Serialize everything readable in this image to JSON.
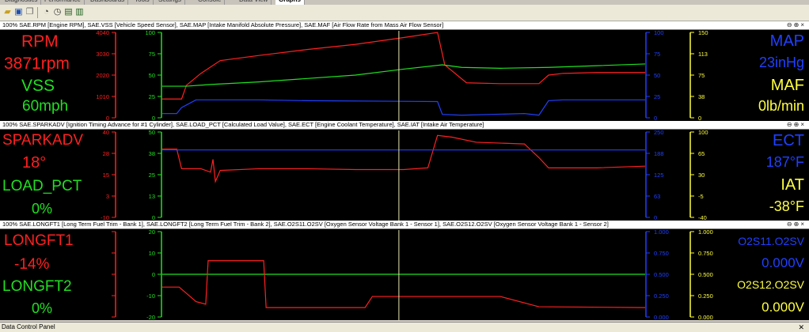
{
  "tabs": [
    "Diagnostics",
    "Performance",
    "Dashboards",
    "Tools",
    "Settings",
    "Console",
    "Data View",
    "Graphs"
  ],
  "panels": [
    {
      "title": "100% SAE.RPM [Engine RPM], SAE.VSS [Vehicle Speed Sensor], SAE.MAP [Intake Manifold Absolute Pressure], SAE.MAF [Air Flow Rate from Mass Air Flow Sensor]",
      "left": [
        {
          "label": "RPM",
          "value": "3871rpm",
          "color": "#ff2020"
        },
        {
          "label": "VSS",
          "value": "60mph",
          "color": "#20e020"
        }
      ],
      "right": [
        {
          "label": "MAP",
          "value": "23inHg",
          "color": "#2040ff"
        },
        {
          "label": "MAF",
          "value": "0lb/min",
          "color": "#ffff40"
        }
      ],
      "axes": [
        {
          "color": "#ff2020",
          "ticks": [
            "4040",
            "3030",
            "2020",
            "1010",
            "0"
          ]
        },
        {
          "color": "#20e020",
          "ticks": [
            "100",
            "75",
            "50",
            "25",
            "0"
          ]
        },
        {
          "color": "#2040ff",
          "ticks": [
            "100",
            "75",
            "50",
            "25",
            "0"
          ]
        },
        {
          "color": "#ffff40",
          "ticks": [
            "150",
            "113",
            "75",
            "38",
            "0"
          ]
        }
      ]
    },
    {
      "title": "100% SAE.SPARKADV [Ignition Timing Advance for #1 Cylinder], SAE.LOAD_PCT [Calculated Load Value], SAE.ECT [Engine Coolant Temperature], SAE.IAT [Intake Air Temperature]",
      "left": [
        {
          "label": "SPARKADV",
          "value": "18°",
          "color": "#ff2020"
        },
        {
          "label": "LOAD_PCT",
          "value": "0%",
          "color": "#20e020"
        }
      ],
      "right": [
        {
          "label": "ECT",
          "value": "187°F",
          "color": "#2040ff"
        },
        {
          "label": "IAT",
          "value": "-38°F",
          "color": "#ffff40"
        }
      ],
      "axes": [
        {
          "color": "#ff2020",
          "ticks": [
            "40",
            "28",
            "15",
            "3",
            "-10"
          ]
        },
        {
          "color": "#20e020",
          "ticks": [
            "50",
            "38",
            "25",
            "13",
            "0"
          ]
        },
        {
          "color": "#2040ff",
          "ticks": [
            "250",
            "188",
            "125",
            "63",
            "0"
          ]
        },
        {
          "color": "#ffff40",
          "ticks": [
            "100",
            "65",
            "30",
            "-5",
            "-40"
          ]
        }
      ]
    },
    {
      "title": "100% SAE.LONGFT1 [Long Term Fuel Trim - Bank 1], SAE.LONGFT2 [Long Term Fuel Trim - Bank 2], SAE.O2S11.O2SV [Oxygen Sensor Voltage Bank 1 - Sensor 1], SAE.O2S12.O2SV [Oxygen Sensor Voltage Bank 1 - Sensor 2]",
      "left": [
        {
          "label": "LONGFT1",
          "value": "-14%",
          "color": "#ff2020"
        },
        {
          "label": "LONGFT2",
          "value": "0%",
          "color": "#20e020"
        }
      ],
      "right": [
        {
          "label": "O2S11.O2SV",
          "value": "0.000V",
          "color": "#2040ff"
        },
        {
          "label": "O2S12.O2SV",
          "value": "0.000V",
          "color": "#ffff40"
        }
      ],
      "axes": [
        {
          "color": "#ff2020",
          "ticks": [
            "",
            "",
            "",
            "",
            ""
          ]
        },
        {
          "color": "#20e020",
          "ticks": [
            "20",
            "10",
            "0",
            "-10",
            "-20"
          ]
        },
        {
          "color": "#2040ff",
          "ticks": [
            "1.000",
            "0.750",
            "0.500",
            "0.250",
            "0.000"
          ]
        },
        {
          "color": "#ffff40",
          "ticks": [
            "1.000",
            "0.750",
            "0.500",
            "0.250",
            "0.000"
          ]
        }
      ]
    }
  ],
  "cursor_fraction": 0.49,
  "bottom_panel": "Data Control Panel",
  "close_glyph": "✕"
}
